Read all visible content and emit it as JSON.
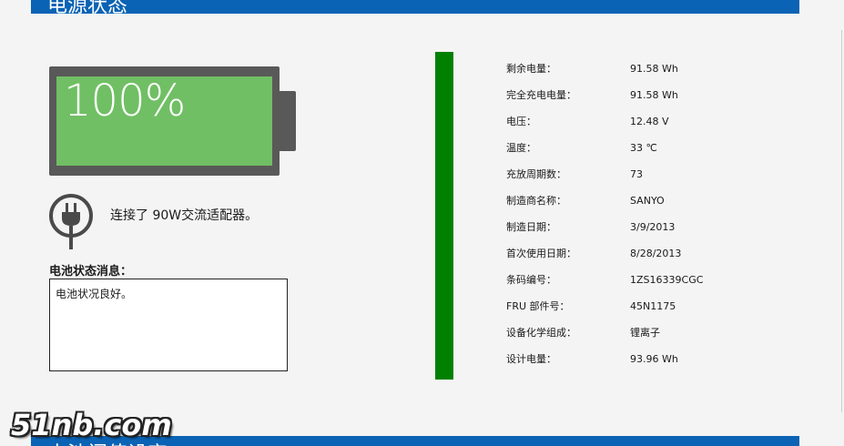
{
  "header": {
    "title": "电源状态"
  },
  "battery": {
    "percent_text": "100%",
    "level": 100,
    "fill_color": "#70bf64"
  },
  "adapter": {
    "icon": "plug-icon",
    "text": "连接了 90W交流适配器。"
  },
  "status_message": {
    "heading": "电池状态消息：",
    "text": "电池状况良好。"
  },
  "charge_indicator": {
    "level": 100,
    "color": "#008000"
  },
  "details": [
    {
      "label": "剩余电量：",
      "value": "91.58 Wh"
    },
    {
      "label": "完全充电电量：",
      "value": "91.58 Wh"
    },
    {
      "label": "电压：",
      "value": "12.48 V"
    },
    {
      "label": "温度：",
      "value": "33 ℃"
    },
    {
      "label": "充放周期数：",
      "value": "73"
    },
    {
      "label": "制造商名称：",
      "value": "SANYO"
    },
    {
      "label": "制造日期：",
      "value": "3/9/2013"
    },
    {
      "label": "首次使用日期：",
      "value": "8/28/2013"
    },
    {
      "label": "条码编号：",
      "value": "1ZS16339CGC"
    },
    {
      "label": "FRU 部件号：",
      "value": "45N1175"
    },
    {
      "label": "设备化学组成：",
      "value": "锂离子"
    },
    {
      "label": "设计电量：",
      "value": "93.96 Wh"
    }
  ],
  "next_section": {
    "title": "电池阈值设定"
  },
  "watermark": {
    "text": "51nb.com"
  },
  "colors": {
    "accent": "#0a63b4",
    "battery_body": "#595959"
  }
}
